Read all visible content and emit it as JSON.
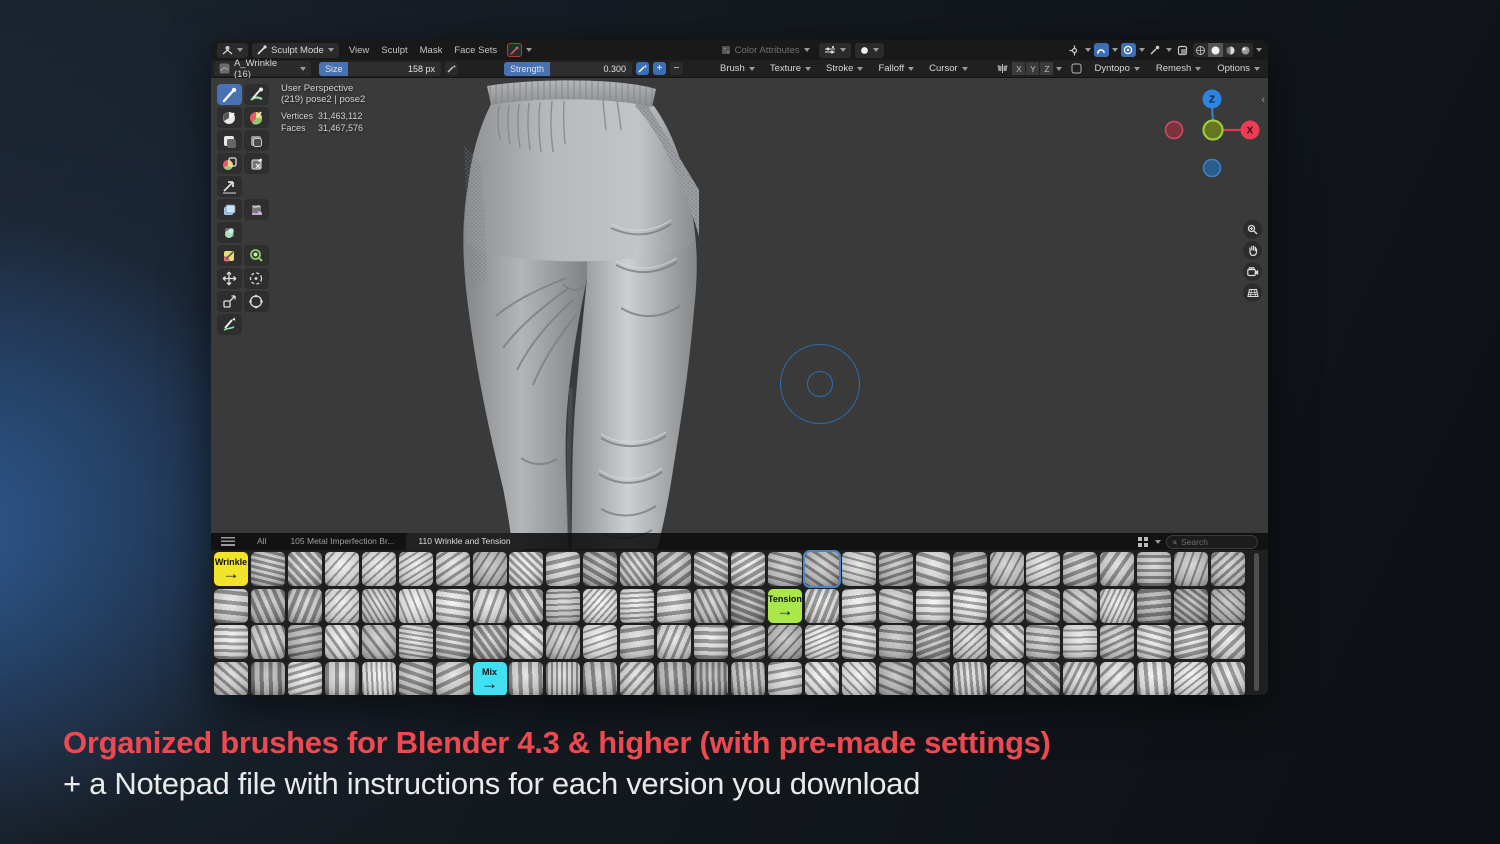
{
  "topbar": {
    "mode": "Sculpt Mode",
    "menus": [
      "View",
      "Sculpt",
      "Mask",
      "Face Sets"
    ],
    "color_attributes": "Color Attributes"
  },
  "tool_settings": {
    "brush_name": "A_Wrinkle (16)",
    "size": {
      "label": "Size",
      "value": "158 px",
      "fill_pct": 24
    },
    "strength": {
      "label": "Strength",
      "value": "0.300",
      "fill_pct": 36
    },
    "plus": "+",
    "minus": "−",
    "dropdowns": [
      "Brush",
      "Texture",
      "Stroke",
      "Falloff",
      "Cursor"
    ],
    "axis_toggles": [
      "X",
      "Y",
      "Z"
    ],
    "right_dropdowns": [
      "Dyntopo",
      "Remesh",
      "Options"
    ]
  },
  "viewport": {
    "perspective": "User Perspective",
    "object_info": "(219) pose2 | pose2",
    "vertices_label": "Vertices",
    "vertices_value": "31,463,112",
    "faces_label": "Faces",
    "faces_value": "31,467,576",
    "gizmo": {
      "z_label": "Z",
      "x_label": "X"
    }
  },
  "asset_shelf": {
    "tabs": [
      {
        "label": "All",
        "active": false
      },
      {
        "label": "105 Metal Imperfection Br...",
        "active": false
      },
      {
        "label": "110 Wrinkle and Tension",
        "active": true
      }
    ],
    "search_placeholder": "Search",
    "grid": {
      "rows": 4,
      "cols": 28,
      "special_tiles": [
        {
          "row": 0,
          "col": 0,
          "label": "Wrinkle",
          "arrow": "→",
          "color": "#f2e42a"
        },
        {
          "row": 0,
          "col": 16,
          "selected": true
        },
        {
          "row": 1,
          "col": 15,
          "label": "Tension",
          "arrow": "→",
          "color": "#a9e74b"
        },
        {
          "row": 3,
          "col": 7,
          "label": "Mix",
          "arrow": "→",
          "color": "#41e0f2"
        }
      ]
    }
  },
  "caption": {
    "line1": "Organized brushes for Blender 4.3 & higher (with pre-made settings)",
    "line2": "+ a Notepad file with instructions for each version you download",
    "line1_color": "#ee4950"
  },
  "colors": {
    "accent_blue": "#4772b3",
    "gizmo_z_blue": "#2f83e3",
    "gizmo_x_red": "#ee3b55",
    "gizmo_green_ring": "#9ace3b"
  },
  "tools": [
    {
      "name": "tool-draw",
      "selected": true
    },
    {
      "name": "tool-paint"
    },
    {
      "name": "tool-mask"
    },
    {
      "name": "tool-draw-face-sets"
    },
    {
      "name": "tool-box-mask"
    },
    {
      "name": "tool-box-hide"
    },
    {
      "name": "tool-box-face-set"
    },
    {
      "name": "tool-box-trim"
    },
    {
      "name": "tool-line-project",
      "single": true
    },
    {
      "name": "tool-mesh-filter"
    },
    {
      "name": "tool-cloth-filter"
    },
    {
      "name": "tool-color-filter",
      "single": true
    },
    {
      "name": "tool-mask-by-color"
    },
    {
      "name": "tool-edit-face-set"
    },
    {
      "name": "tool-move"
    },
    {
      "name": "tool-rotate"
    },
    {
      "name": "tool-scale"
    },
    {
      "name": "tool-transform"
    },
    {
      "name": "tool-annotate",
      "single": true
    }
  ]
}
